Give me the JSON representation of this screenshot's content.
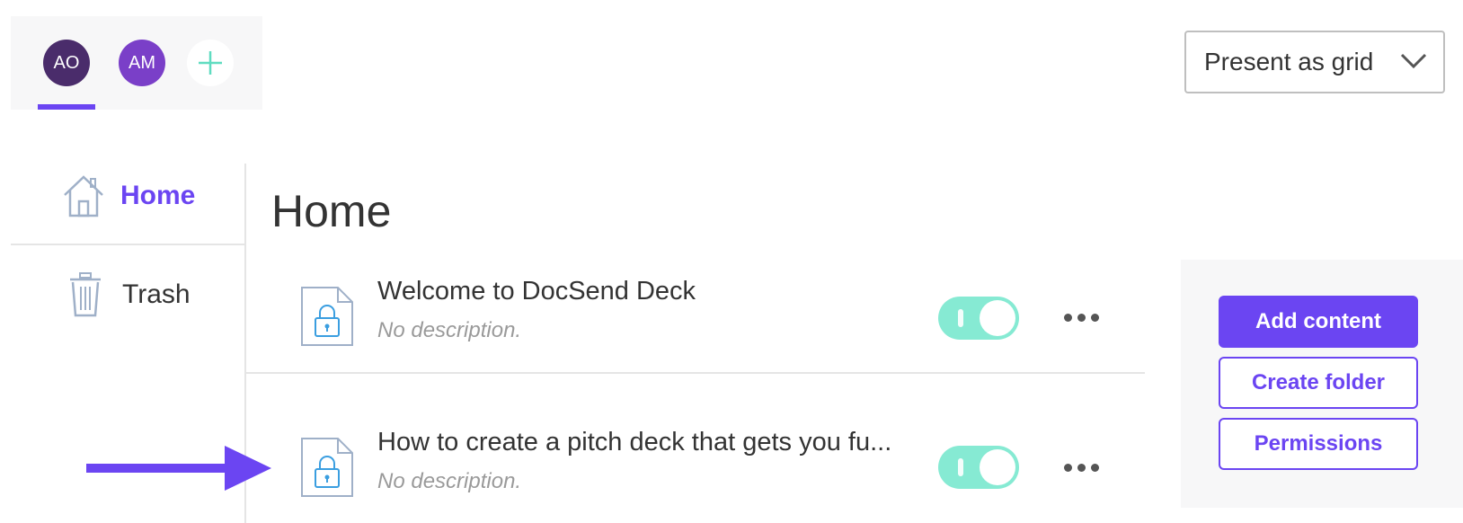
{
  "users": {
    "avatars": [
      {
        "initials": "AO",
        "color": "#4a2c6b",
        "active": true
      },
      {
        "initials": "AM",
        "color": "#7a3fc8",
        "active": false
      }
    ],
    "add_icon": "plus-icon"
  },
  "view_select": {
    "value": "Present as grid",
    "icon": "chevron-down-icon"
  },
  "sidebar": {
    "items": [
      {
        "label": "Home",
        "icon": "home-icon",
        "active": true
      },
      {
        "label": "Trash",
        "icon": "trash-icon",
        "active": false
      }
    ]
  },
  "main": {
    "title": "Home",
    "documents": [
      {
        "title": "Welcome to DocSend Deck",
        "description": "No description.",
        "icon": "locked-document-icon",
        "enabled": true
      },
      {
        "title": "How to create a pitch deck that gets you fu...",
        "description": "No description.",
        "icon": "locked-document-icon",
        "enabled": true
      }
    ]
  },
  "actions": {
    "add_content": "Add content",
    "create_folder": "Create folder",
    "permissions": "Permissions"
  },
  "colors": {
    "accent": "#6b45f2",
    "toggle_on": "#86ead3",
    "add_plus": "#5fdcc0"
  }
}
